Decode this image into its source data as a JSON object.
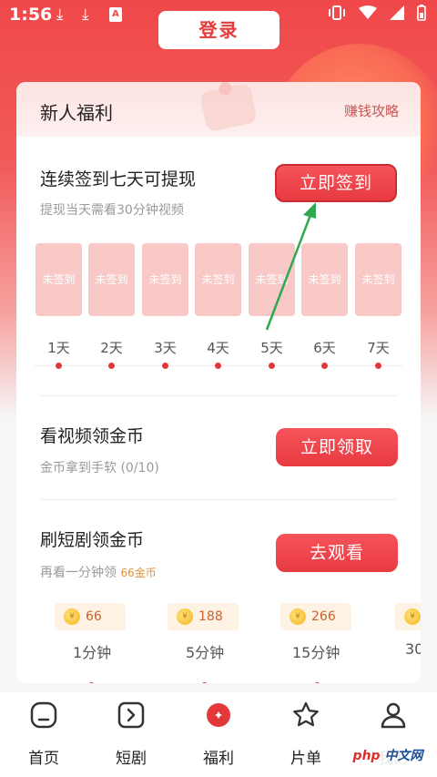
{
  "status_bar": {
    "time": "1:56",
    "notif_badge": "A"
  },
  "header": {
    "login_label": "登录"
  },
  "card": {
    "title": "新人福利",
    "strategy_link": "赚钱攻略",
    "checkin": {
      "title": "连续签到七天可提现",
      "subtitle": "提现当天需看30分钟视频",
      "button": "立即签到",
      "days": [
        {
          "status": "未签到",
          "label": "1天"
        },
        {
          "status": "未签到",
          "label": "2天"
        },
        {
          "status": "未签到",
          "label": "3天"
        },
        {
          "status": "未签到",
          "label": "4天"
        },
        {
          "status": "未签到",
          "label": "5天"
        },
        {
          "status": "未签到",
          "label": "6天"
        },
        {
          "status": "未签到",
          "label": "7天"
        }
      ]
    },
    "video_task": {
      "title": "看视频领金币",
      "subtitle": "金币拿到手软 (0/10)",
      "button": "立即领取"
    },
    "drama_task": {
      "title": "刷短剧领金币",
      "subtitle_prefix": "再看一分钟领 ",
      "subtitle_reward": "66金币",
      "button": "去观看",
      "milestones": [
        {
          "coins": "66",
          "label": "1分钟"
        },
        {
          "coins": "188",
          "label": "5分钟"
        },
        {
          "coins": "266",
          "label": "15分钟"
        },
        {
          "coins": "",
          "label": "30"
        }
      ]
    }
  },
  "tabbar": {
    "items": [
      {
        "label": "首页",
        "icon": "home-icon"
      },
      {
        "label": "短剧",
        "icon": "play-icon"
      },
      {
        "label": "福利",
        "icon": "welfare-icon"
      },
      {
        "label": "片单",
        "icon": "star-icon"
      },
      {
        "label": "我的",
        "icon": "profile-icon"
      }
    ]
  },
  "watermark": {
    "brand": "php",
    "text": "中文网"
  },
  "colors": {
    "accent": "#e83a41",
    "hero_top": "#f0484a",
    "day_box": "#f8c9c6"
  }
}
